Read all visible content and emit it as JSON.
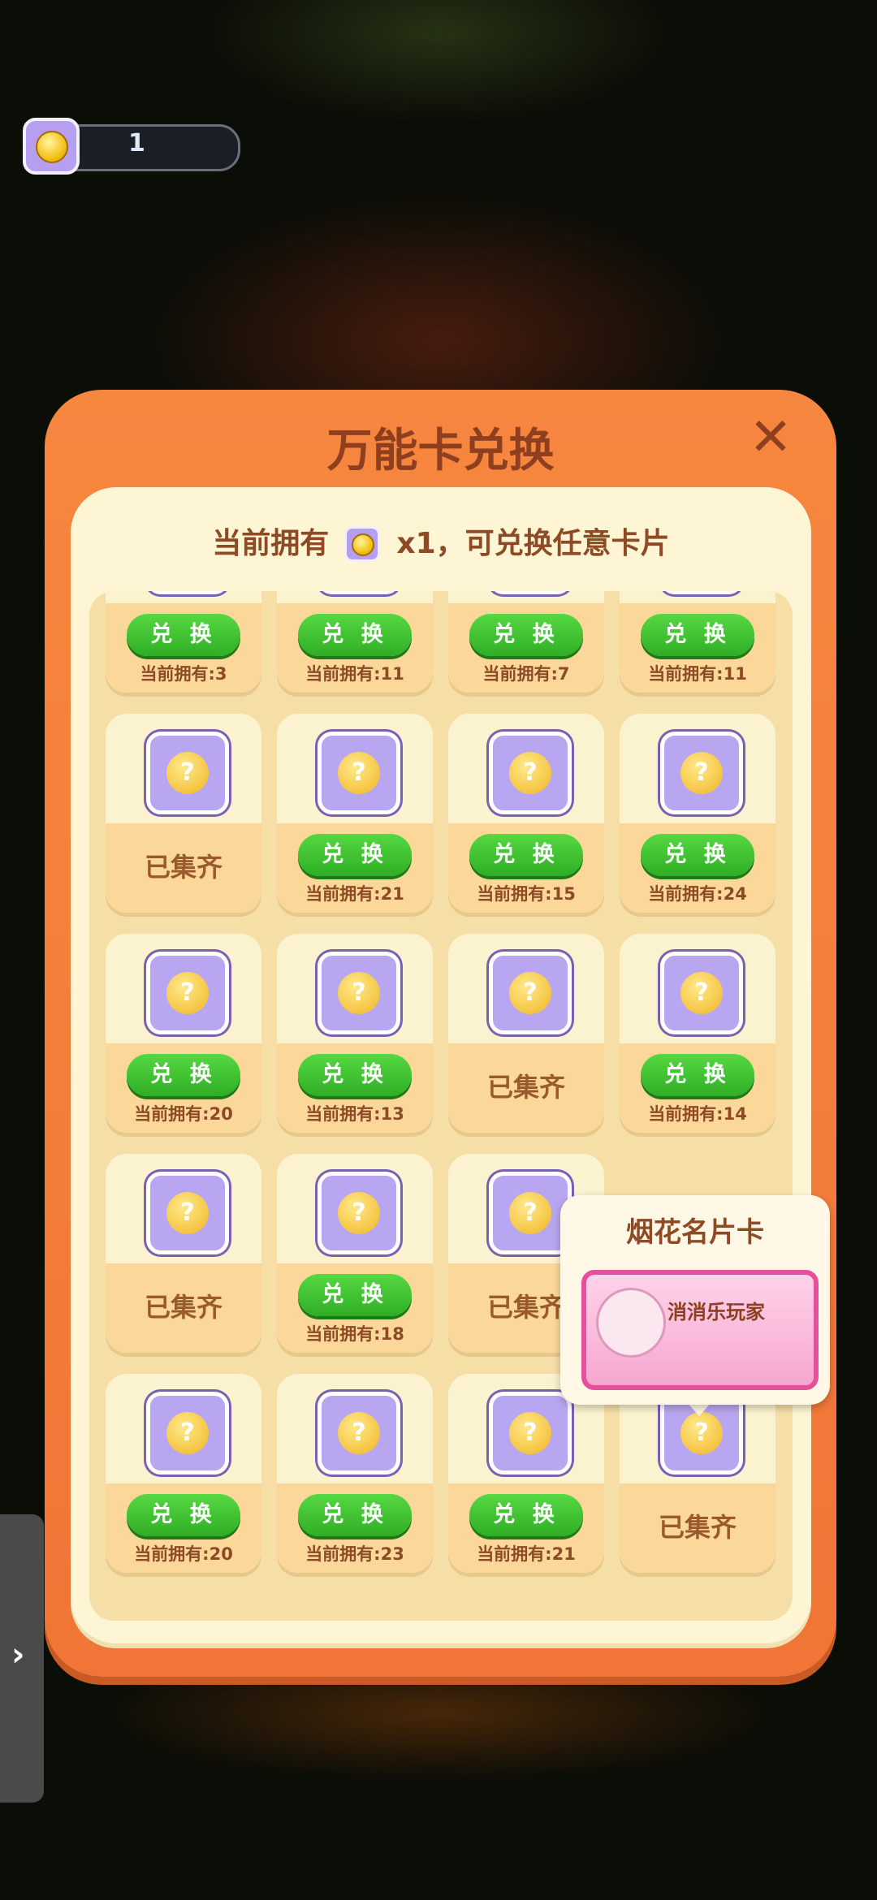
{
  "counter": {
    "value": "1"
  },
  "dialog": {
    "title": "万能卡兑换",
    "close_icon": "close-icon",
    "own_prefix": "当前拥有",
    "own_suffix": "x1，可兑换任意卡片"
  },
  "cards": [
    {
      "state": "exchange",
      "button": "兑 换",
      "owned": "当前拥有:3"
    },
    {
      "state": "exchange",
      "button": "兑 换",
      "owned": "当前拥有:11"
    },
    {
      "state": "exchange",
      "button": "兑 换",
      "owned": "当前拥有:7"
    },
    {
      "state": "exchange",
      "button": "兑 换",
      "owned": "当前拥有:11"
    },
    {
      "state": "done",
      "label": "已集齐"
    },
    {
      "state": "exchange",
      "button": "兑 换",
      "owned": "当前拥有:21"
    },
    {
      "state": "exchange",
      "button": "兑 换",
      "owned": "当前拥有:15"
    },
    {
      "state": "exchange",
      "button": "兑 换",
      "owned": "当前拥有:24"
    },
    {
      "state": "exchange",
      "button": "兑 换",
      "owned": "当前拥有:20"
    },
    {
      "state": "exchange",
      "button": "兑 换",
      "owned": "当前拥有:13"
    },
    {
      "state": "done",
      "label": "已集齐"
    },
    {
      "state": "exchange",
      "button": "兑 换",
      "owned": "当前拥有:14"
    },
    {
      "state": "done",
      "label": "已集齐"
    },
    {
      "state": "exchange",
      "button": "兑 换",
      "owned": "当前拥有:18"
    },
    {
      "state": "done",
      "label": "已集齐"
    },
    {
      "state": "hidden"
    },
    {
      "state": "exchange",
      "button": "兑 换",
      "owned": "当前拥有:20"
    },
    {
      "state": "exchange",
      "button": "兑 换",
      "owned": "当前拥有:23"
    },
    {
      "state": "exchange",
      "button": "兑 换",
      "owned": "当前拥有:21"
    },
    {
      "state": "done",
      "label": "已集齐"
    }
  ],
  "tooltip": {
    "title": "烟花名片卡",
    "card_name": "消消乐玩家"
  },
  "side_handle": {
    "icon": "chevron-right-icon",
    "glyph": "›"
  }
}
